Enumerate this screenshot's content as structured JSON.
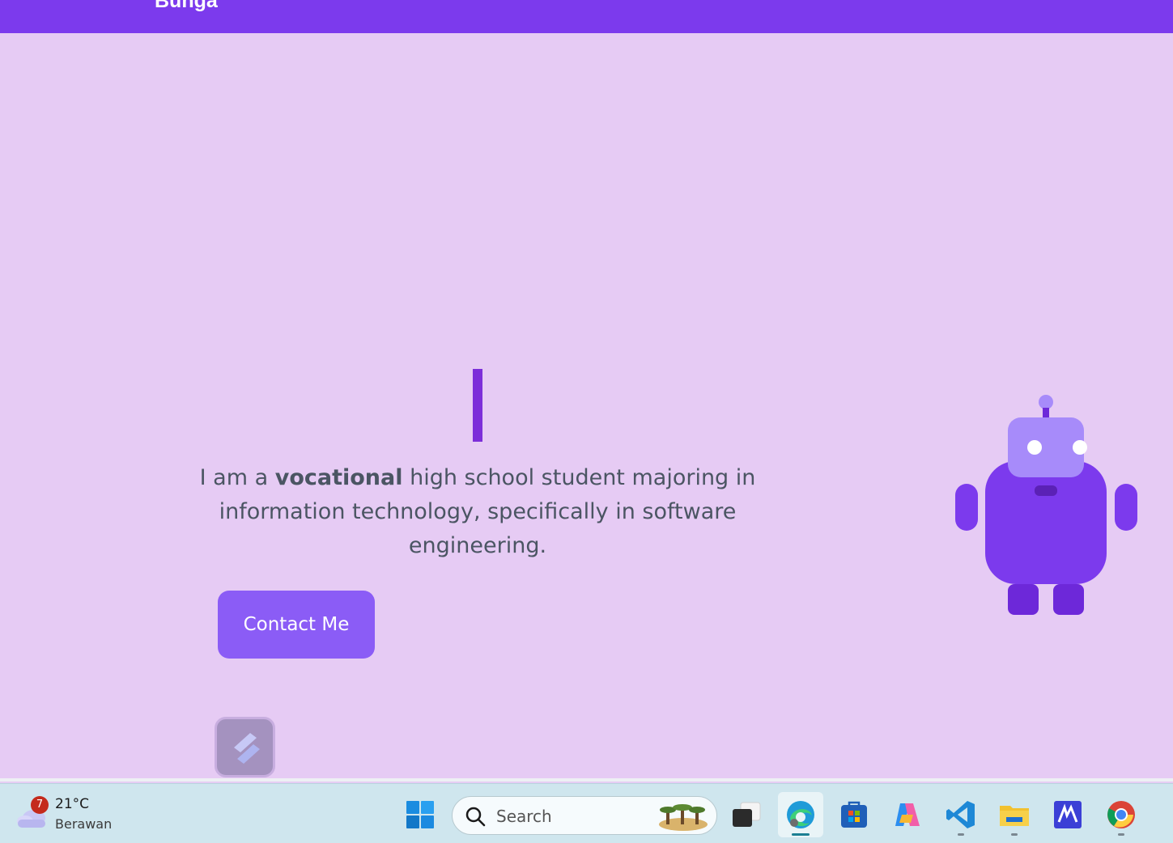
{
  "navbar": {
    "brand": "Bunga"
  },
  "hero": {
    "intro_prefix": "I am a ",
    "intro_bold": "vocational",
    "intro_suffix": " high school student majoring in information technology, specifically in software engineering.",
    "contact_label": "Contact Me"
  },
  "colors": {
    "background": "#e6cbf4",
    "navbar": "#7c3aed",
    "button": "#8b5cf6",
    "robot_body": "#7c3aed",
    "robot_head": "#a78bfa",
    "robot_limbs": "#6d28d9"
  },
  "taskbar": {
    "weather": {
      "badge": "7",
      "temperature": "21°C",
      "condition": "Berawan"
    },
    "search": {
      "placeholder": "Search"
    },
    "apps": [
      {
        "name": "start-menu",
        "icon": "windows-logo-icon"
      },
      {
        "name": "task-view",
        "icon": "task-view-icon"
      },
      {
        "name": "edge",
        "icon": "edge-icon",
        "active": true
      },
      {
        "name": "store",
        "icon": "store-icon"
      },
      {
        "name": "copilot",
        "icon": "copilot-icon"
      },
      {
        "name": "vscode",
        "icon": "vscode-icon"
      },
      {
        "name": "file-explorer",
        "icon": "folder-icon"
      },
      {
        "name": "app-m",
        "icon": "m-app-icon"
      },
      {
        "name": "chrome",
        "icon": "chrome-icon"
      }
    ]
  }
}
